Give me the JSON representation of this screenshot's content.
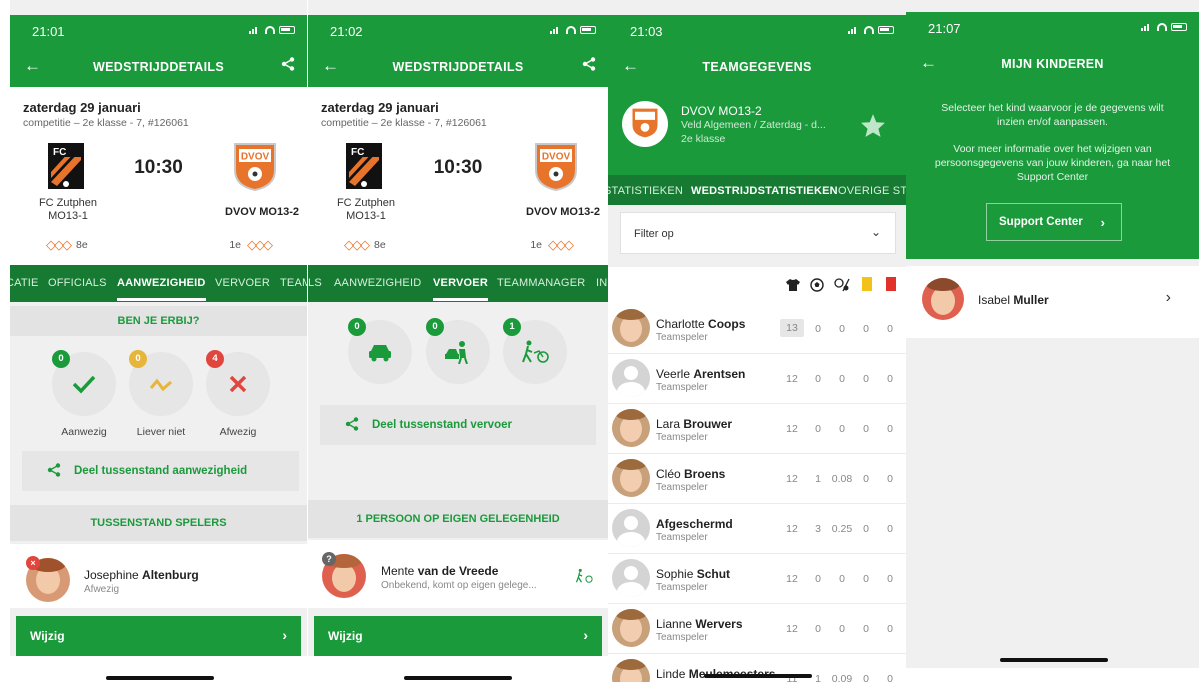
{
  "screens": [
    {
      "time": "21:01",
      "title": "WEDSTRIJDDETAILS",
      "date": "zaterdag 29 januari",
      "competition": "competitie – 2e klasse - 7, #126061",
      "kickoff": "10:30",
      "home": {
        "name": "FC Zutphen MO13-1",
        "rank": "8e",
        "logo_text": "FC"
      },
      "away": {
        "name": "DVOV MO13-2",
        "rank": "1e",
        "logo_text": "DVOV"
      },
      "tabs": [
        "CATIE",
        "OFFICIALS",
        "AANWEZIGHEID",
        "VERVOER",
        "TEAM"
      ],
      "active_tab": "AANWEZIGHEID",
      "section_title": "BEN JE ERBIJ?",
      "options": [
        {
          "label": "Aanwezig",
          "count": "0",
          "badge_color": "#1b9a3c",
          "icon": "check-icon"
        },
        {
          "label": "Liever niet",
          "count": "0",
          "badge_color": "#e6b53a",
          "icon": "zigzag-icon"
        },
        {
          "label": "Afwezig",
          "count": "4",
          "badge_color": "#e0463e",
          "icon": "cross-icon"
        }
      ],
      "share_label": "Deel tussenstand aanwezigheid",
      "standings_title": "TUSSENSTAND SPELERS",
      "player": {
        "first": "Josephine ",
        "last": "Altenburg",
        "status": "Afwezig"
      },
      "button": "Wijzig"
    },
    {
      "time": "21:02",
      "title": "WEDSTRIJDDETAILS",
      "date": "zaterdag 29 januari",
      "competition": "competitie – 2e klasse - 7, #126061",
      "kickoff": "10:30",
      "home": {
        "name": "FC Zutphen MO13-1",
        "rank": "8e",
        "logo_text": "FC"
      },
      "away": {
        "name": "DVOV MO13-2",
        "rank": "1e",
        "logo_text": "DVOV"
      },
      "tabs": [
        "LS",
        "AANWEZIGHEID",
        "VERVOER",
        "TEAMMANAGER",
        "IN"
      ],
      "active_tab": "VERVOER",
      "options": [
        {
          "count": "0",
          "icon": "car-icon"
        },
        {
          "count": "0",
          "icon": "passenger-icon"
        },
        {
          "count": "1",
          "icon": "bike-icon"
        }
      ],
      "share_label": "Deel tussenstand vervoer",
      "section_title": "1 PERSOON OP EIGEN GELEGENHEID",
      "player": {
        "first": "Mente ",
        "last": "van de Vreede",
        "status": "Onbekend, komt op eigen gelege..."
      },
      "button": "Wijzig"
    },
    {
      "time": "21:03",
      "title": "TEAMGEGEVENS",
      "team": {
        "name": "DVOV MO13-2",
        "location": "Veld Algemeen / Zaterdag - d...",
        "class": "2e klasse"
      },
      "tabs": [
        "STATISTIEKEN",
        "WEDSTRIJDSTATISTIEKEN",
        "OVERIGE STA"
      ],
      "active_tab": "WEDSTRIJDSTATISTIEKEN",
      "filter_label": "Filter op",
      "players": [
        {
          "first": "Charlotte ",
          "last": "Coops",
          "role": "Teamspeler",
          "stats": [
            "13",
            "0",
            "0",
            "0",
            "0"
          ],
          "photo": true
        },
        {
          "first": "Veerle ",
          "last": "Arentsen",
          "role": "Teamspeler",
          "stats": [
            "12",
            "0",
            "0",
            "0",
            "0"
          ],
          "photo": false
        },
        {
          "first": "Lara ",
          "last": "Brouwer",
          "role": "Teamspeler",
          "stats": [
            "12",
            "0",
            "0",
            "0",
            "0"
          ],
          "photo": true
        },
        {
          "first": "Cléo ",
          "last": "Broens",
          "role": "Teamspeler",
          "stats": [
            "12",
            "1",
            "0.08",
            "0",
            "0"
          ],
          "photo": true
        },
        {
          "first": "",
          "last": "Afgeschermd",
          "role": "Teamspeler",
          "stats": [
            "12",
            "3",
            "0.25",
            "0",
            "0"
          ],
          "photo": false
        },
        {
          "first": "Sophie ",
          "last": "Schut",
          "role": "Teamspeler",
          "stats": [
            "12",
            "0",
            "0",
            "0",
            "0"
          ],
          "photo": false
        },
        {
          "first": "Lianne ",
          "last": "Wervers",
          "role": "Teamspeler",
          "stats": [
            "12",
            "0",
            "0",
            "0",
            "0"
          ],
          "photo": true
        },
        {
          "first": "Linde ",
          "last": "Meulemeesters",
          "role": "",
          "stats": [
            "11",
            "1",
            "0.09",
            "0",
            "0"
          ],
          "photo": true
        }
      ]
    },
    {
      "time": "21:07",
      "title": "MIJN KINDEREN",
      "intro": "Selecteer het kind waarvoor je de gegevens wilt inzien en/of aanpassen.",
      "info": "Voor meer informatie over het wijzigen van persoonsgegevens van jouw kinderen, ga naar het Support Center",
      "support_label": "Support Center",
      "kid": {
        "first": "Isabel ",
        "last": "Muller"
      }
    }
  ]
}
